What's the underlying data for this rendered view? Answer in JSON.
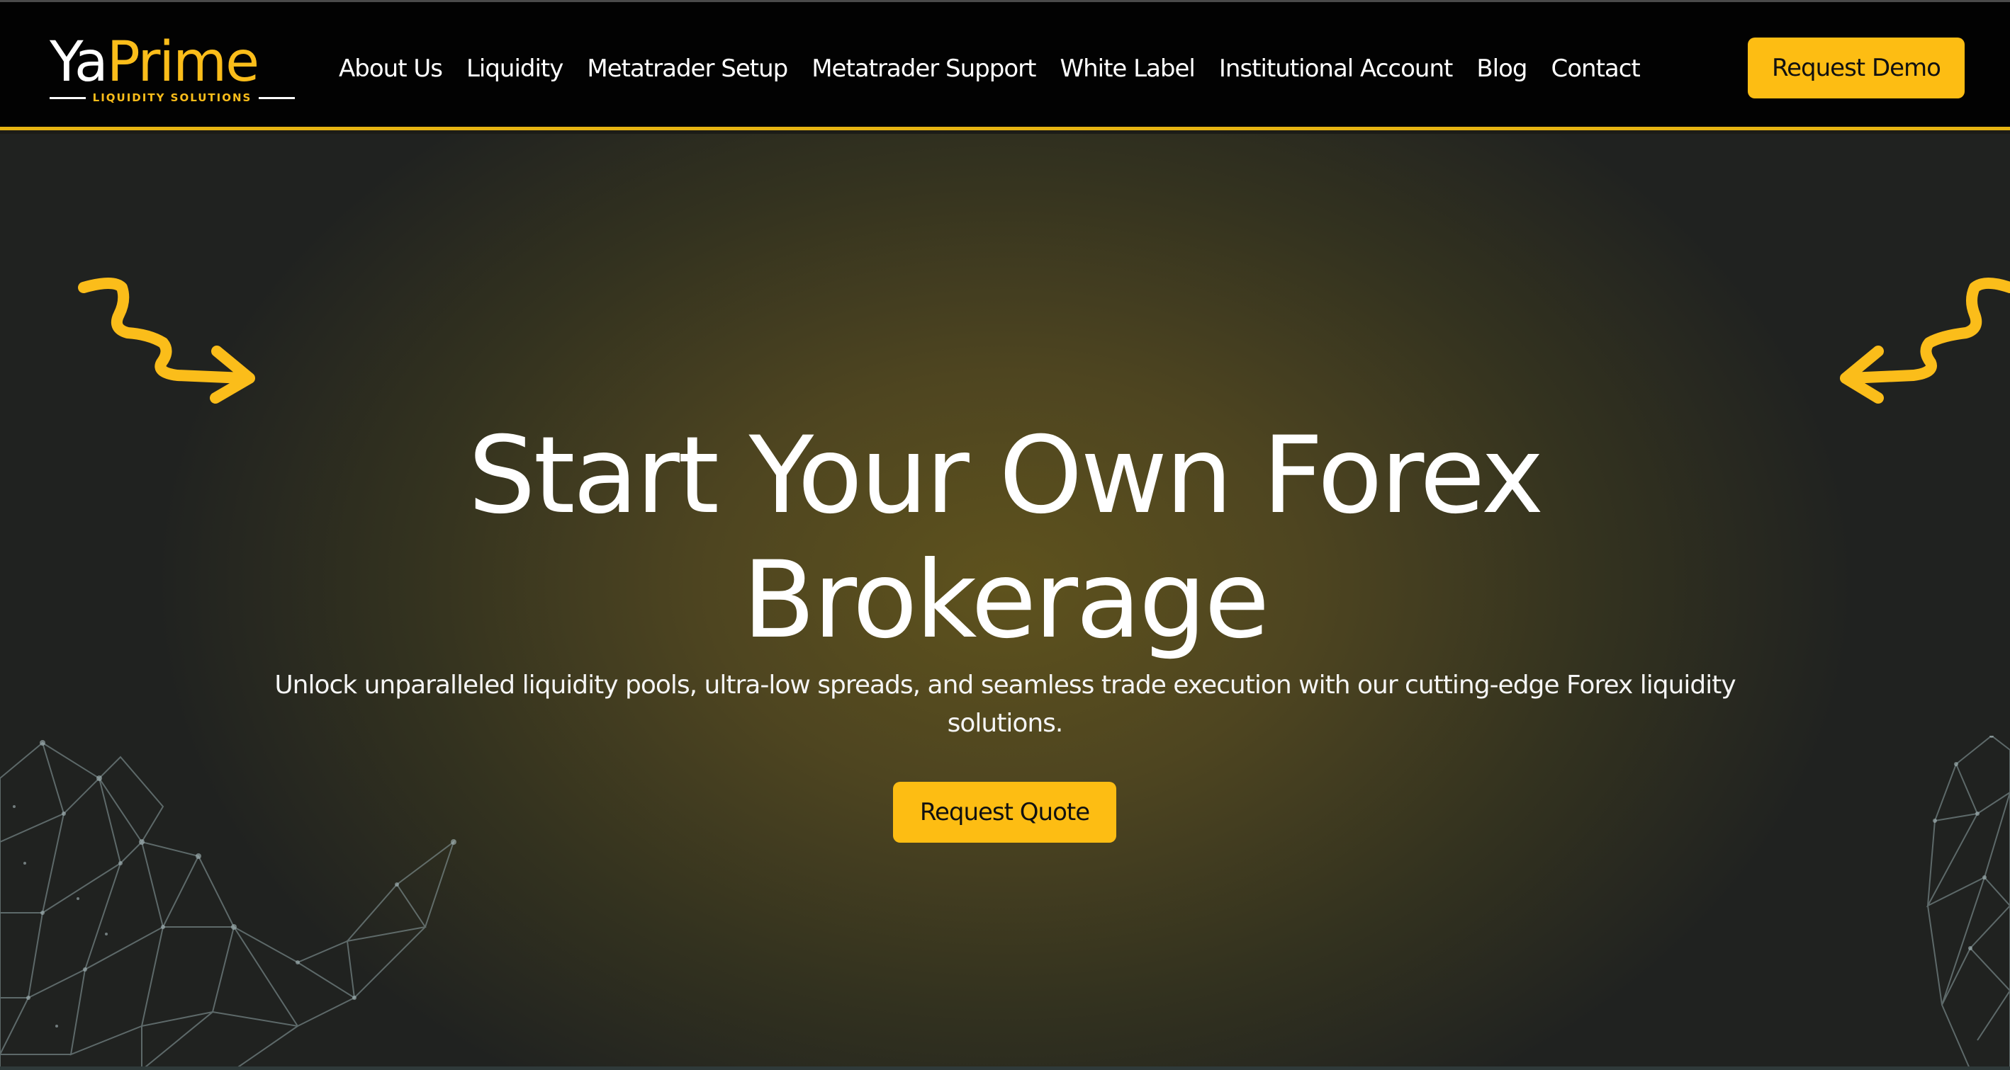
{
  "brand": {
    "name_part1": "Ya",
    "name_part2": "Prime",
    "tagline": "LIQUIDITY SOLUTIONS",
    "accent_color": "#fdbd13"
  },
  "nav": {
    "items": [
      {
        "label": "About Us"
      },
      {
        "label": "Liquidity"
      },
      {
        "label": "Metatrader Setup"
      },
      {
        "label": "Metatrader Support"
      },
      {
        "label": "White Label"
      },
      {
        "label": "Institutional Account"
      },
      {
        "label": "Blog"
      },
      {
        "label": "Contact"
      }
    ],
    "cta_label": "Request Demo"
  },
  "hero": {
    "title_line1": "Start Your Own Forex",
    "title_line2": "Brokerage",
    "subtitle": "Unlock unparalleled liquidity pools, ultra-low spreads, and seamless trade execution with our cutting-edge Forex liquidity solutions.",
    "cta_label": "Request Quote",
    "decorations": [
      "zigzag-arrow-icon",
      "zigzag-arrow-icon",
      "wireframe-bull",
      "wireframe-bear"
    ]
  }
}
